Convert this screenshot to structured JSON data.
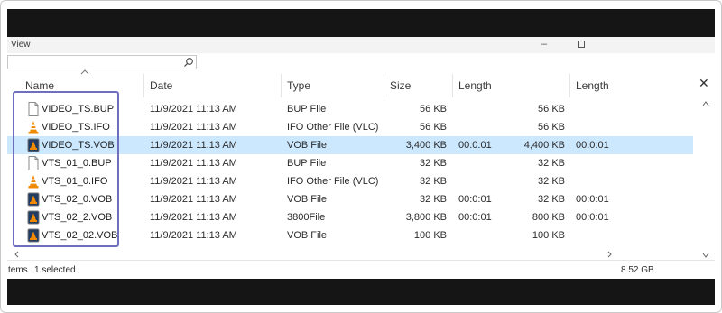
{
  "menu": {
    "view_label": "View"
  },
  "window_controls": {
    "minimize": "–"
  },
  "search": {
    "placeholder": ""
  },
  "columns": [
    "Name",
    "Date",
    "Type",
    "Size",
    "Length",
    "Length"
  ],
  "rows": [
    {
      "name": "VIDEO_TS.BUP",
      "date": "11/9/2021 11:13 AM",
      "type": "BUP File",
      "size": "56 KB",
      "length": "",
      "size2": "56 KB",
      "length2": "",
      "icon": "file-icon",
      "selected": false
    },
    {
      "name": "VIDEO_TS.IFO",
      "date": "11/9/2021 11:13 AM",
      "type": "IFO Other File (VLC)",
      "size": "56 KB",
      "length": "",
      "size2": "56 KB",
      "length2": "",
      "icon": "vlc-cone-icon",
      "selected": false
    },
    {
      "name": "VIDEO_TS.VOB",
      "date": "11/9/2021 11:13 AM",
      "type": "VOB File",
      "size": "3,400 KB",
      "length": "00:0:01",
      "size2": "4,400 KB",
      "length2": "00:0:01",
      "icon": "video-file-icon",
      "selected": true
    },
    {
      "name": "VTS_01_0.BUP",
      "date": "11/9/2021 11:13 AM",
      "type": "BUP File",
      "size": "32 KB",
      "length": "",
      "size2": "32 KB",
      "length2": "",
      "icon": "file-icon",
      "selected": false
    },
    {
      "name": "VTS_01_0.IFO",
      "date": "11/9/2021 11:13 AM",
      "type": "IFO Other File (VLC)",
      "size": "32 KB",
      "length": "",
      "size2": "32 KB",
      "length2": "",
      "icon": "vlc-cone-icon",
      "selected": false
    },
    {
      "name": "VTS_02_0.VOB",
      "date": "11/9/2021 11:13 AM",
      "type": "VOB File",
      "size": "32 KB",
      "length": "00:0:01",
      "size2": "32 KB",
      "length2": "00:0:01",
      "icon": "video-file-icon",
      "selected": false
    },
    {
      "name": "VTS_02_2.VOB",
      "date": "11/9/2021 11:13 AM",
      "type": "3800File",
      "size": "3,800 KB",
      "length": "00:0:01",
      "size2": "800 KB",
      "length2": "00:0:01",
      "icon": "video-file-icon",
      "selected": false
    },
    {
      "name": "VTS_02_02.VOB",
      "date": "11/9/2021 11:13 AM",
      "type": "VOB File",
      "size": "100 KB",
      "length": "",
      "size2": "100 KB",
      "length2": "",
      "icon": "video-file-icon",
      "selected": false
    }
  ],
  "status": {
    "items": "tems",
    "selected": "1 selected",
    "free": "8.52 GB"
  },
  "colors": {
    "selection": "#cce8ff",
    "highlight_box": "#6f6fbf",
    "frame_bar": "#151515"
  }
}
